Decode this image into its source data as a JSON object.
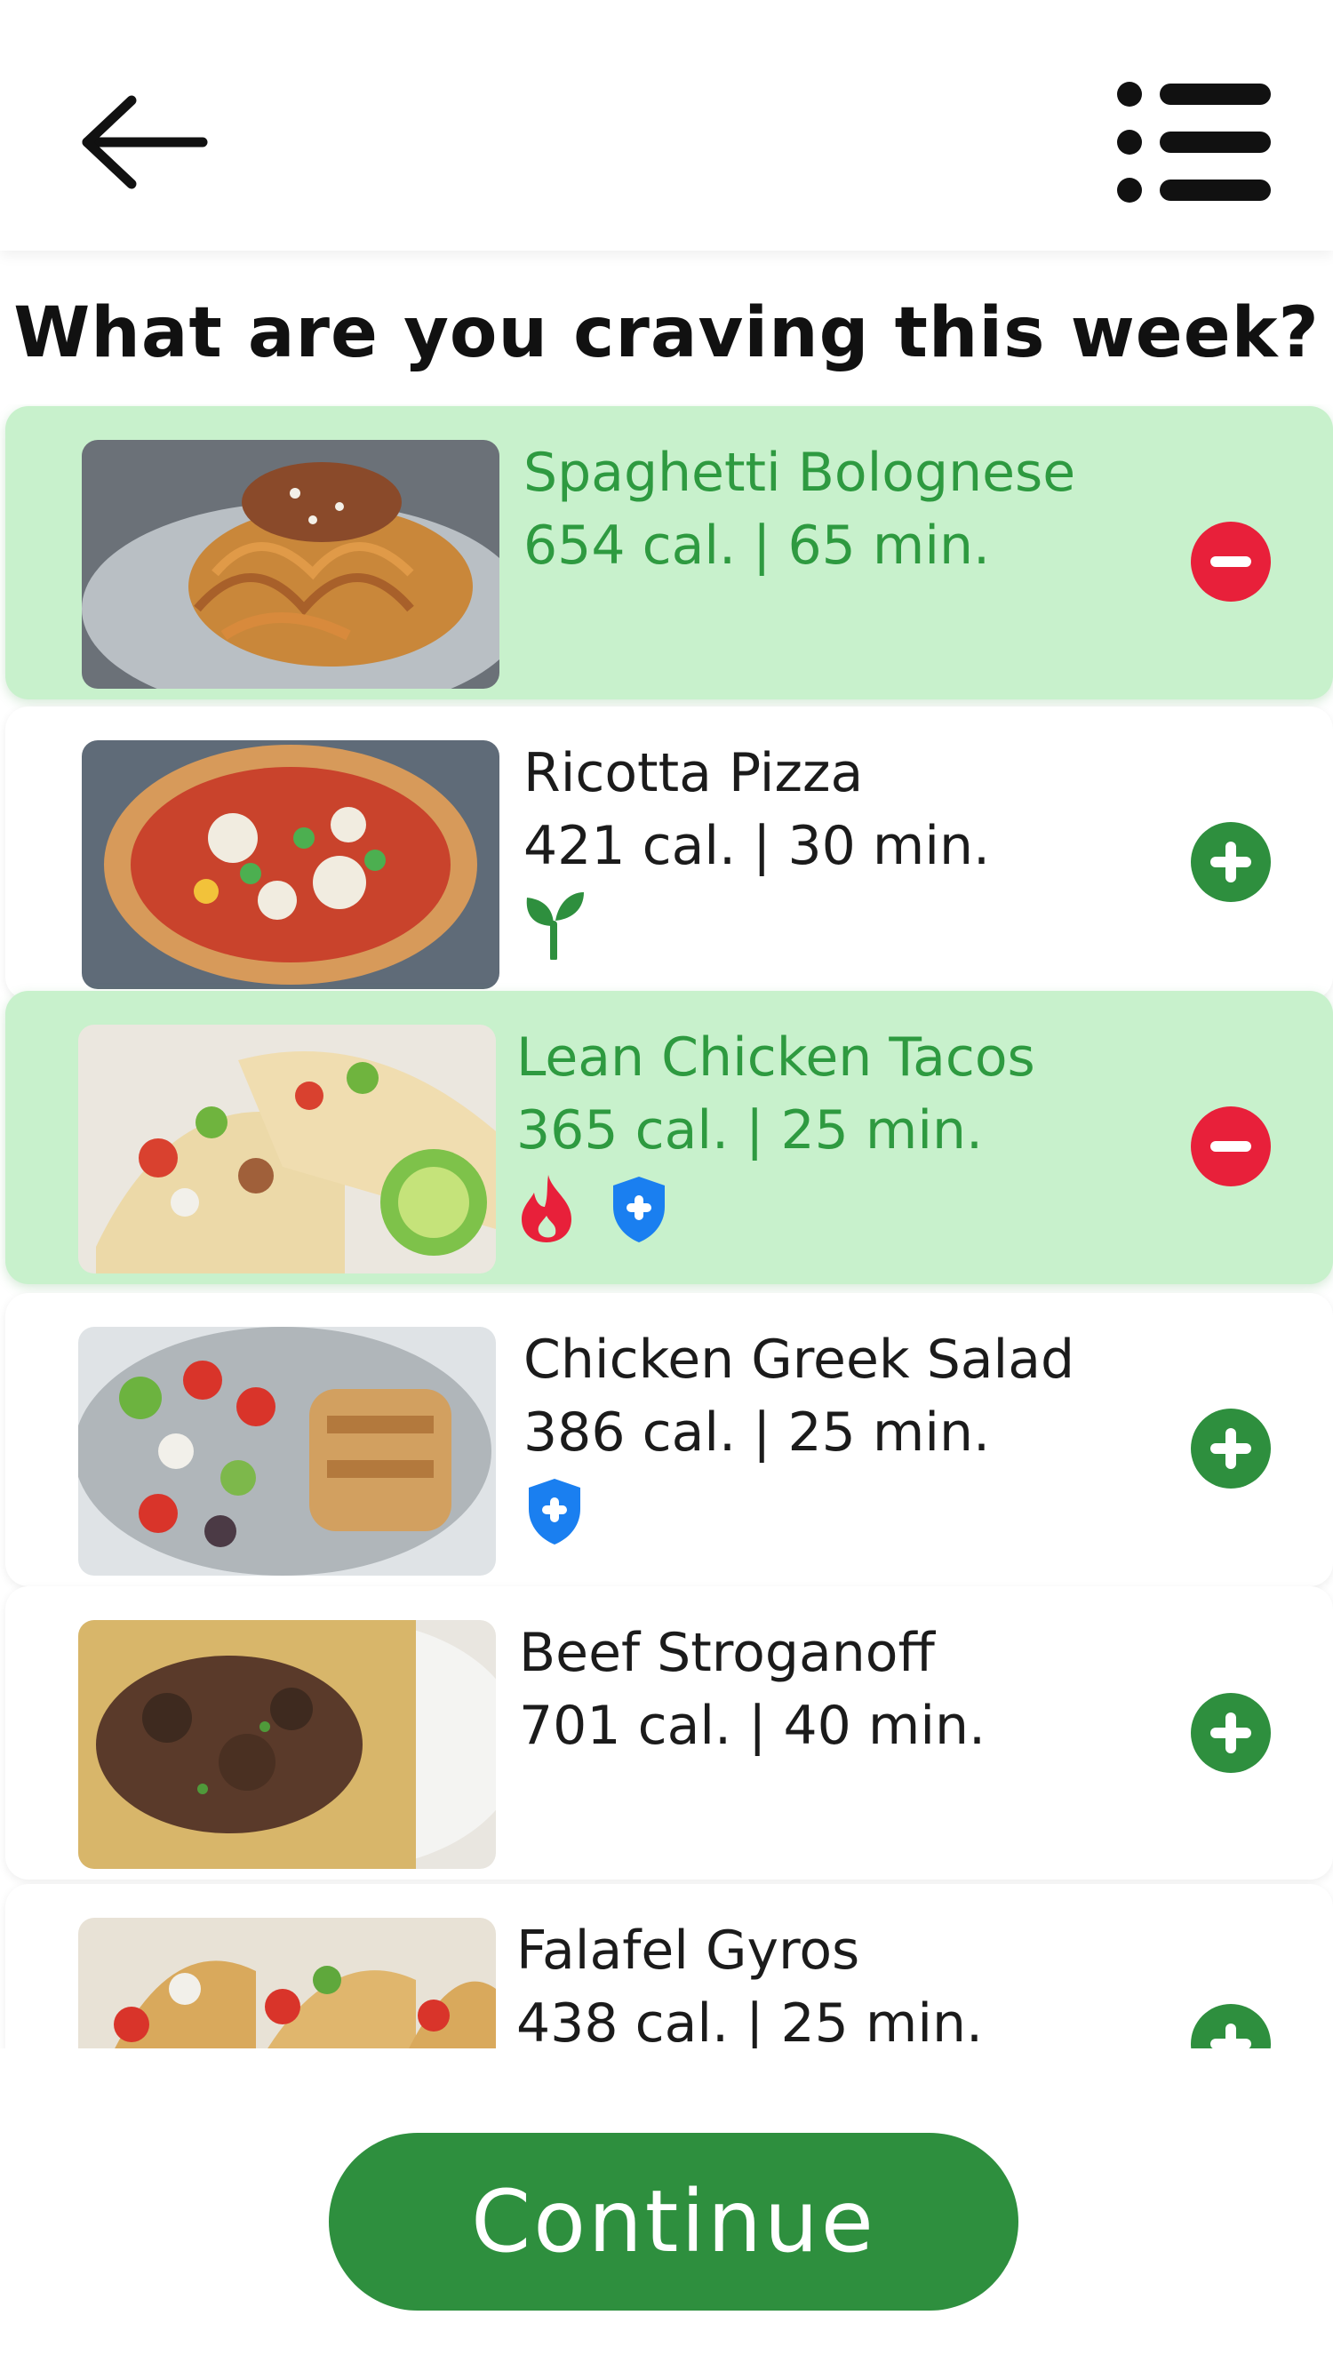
{
  "header": {
    "back_icon": "arrow-left-icon",
    "menu_icon": "list-menu-icon"
  },
  "page_title": "What are you craving this week?",
  "colors": {
    "selected_bg": "#c8f1cc",
    "selected_text": "#2e9a40",
    "add_button": "#2e8f3e",
    "remove_button": "#e8203a",
    "continue_button": "#2e8f3e"
  },
  "meals": [
    {
      "name": "Spaghetti Bolognese",
      "meta": "654 cal. | 65 min.",
      "selected": true,
      "badges": [],
      "action": "remove-icon"
    },
    {
      "name": "Ricotta Pizza",
      "meta": "421 cal. | 30 min.",
      "selected": false,
      "badges": [
        "vegetarian-sprout-icon"
      ],
      "action": "add-icon"
    },
    {
      "name": "Lean Chicken Tacos",
      "meta": "365 cal. | 25 min.",
      "selected": true,
      "badges": [
        "spicy-flame-icon",
        "health-shield-icon"
      ],
      "action": "remove-icon"
    },
    {
      "name": "Chicken Greek Salad",
      "meta": "386 cal. | 25 min.",
      "selected": false,
      "badges": [
        "health-shield-icon"
      ],
      "action": "add-icon"
    },
    {
      "name": "Beef Stroganoff",
      "meta": "701 cal. | 40 min.",
      "selected": false,
      "badges": [],
      "action": "add-icon"
    },
    {
      "name": "Falafel Gyros",
      "meta": "438 cal. | 25 min.",
      "selected": false,
      "badges": [],
      "action": "add-icon"
    }
  ],
  "continue_label": "Continue"
}
